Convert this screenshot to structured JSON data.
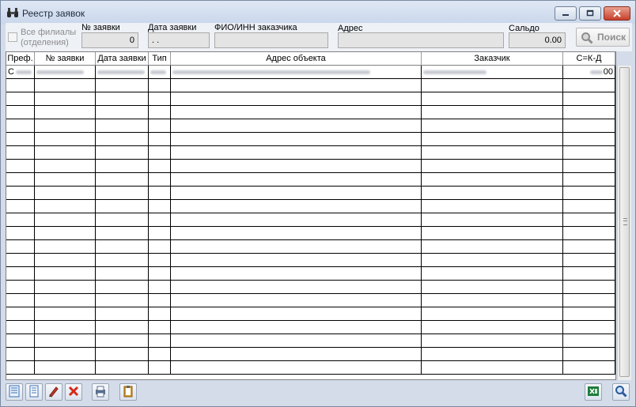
{
  "window": {
    "title": "Реестр заявок",
    "title_icon": "binoculars-icon"
  },
  "filters": {
    "all_branches_line1": "Все филиалы",
    "all_branches_line2": "(отделения)",
    "all_branches_checked": false,
    "request_no_label": "№ заявки",
    "request_no_value": "0",
    "request_date_label": "Дата заявки",
    "request_date_value": " .  .",
    "customer_label": "ФИО/ИНН заказчика",
    "customer_value": "",
    "address_label": "Адрес",
    "address_value": "",
    "balance_label": "Сальдо",
    "balance_value": "0.00",
    "search_label": "Поиск"
  },
  "table": {
    "columns": [
      "Преф.",
      "№ заявки",
      "Дата заявки",
      "Тип",
      "Адрес объекта",
      "Заказчик",
      "С=К-Д"
    ],
    "first_row": {
      "pref": "С",
      "balance": "00"
    }
  },
  "toolbar": {
    "icons": [
      "list-icon",
      "document-icon",
      "edit-pencil-icon",
      "delete-x-icon",
      "print-icon",
      "clipboard-icon",
      "excel-icon",
      "zoom-icon"
    ]
  },
  "colors": {
    "window_bg": "#d4dcea",
    "close_button": "#c7402a",
    "grid_line": "#000000"
  }
}
